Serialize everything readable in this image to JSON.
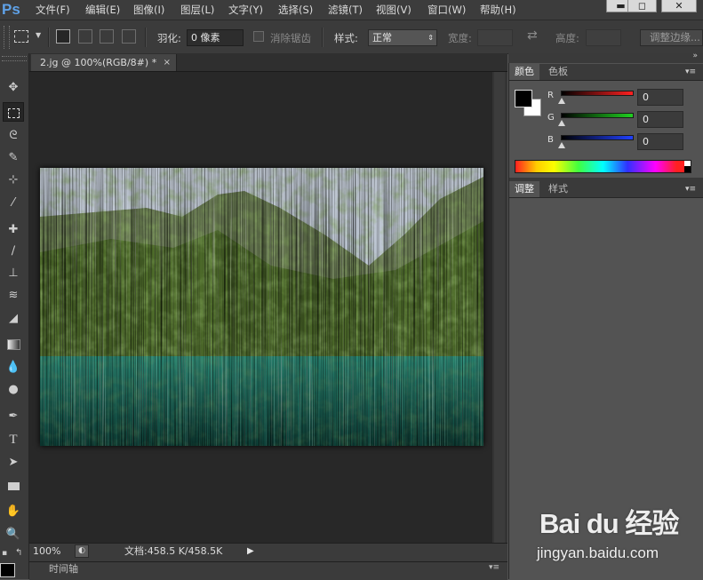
{
  "app": {
    "logo": "Ps"
  },
  "menu": [
    "文件(F)",
    "编辑(E)",
    "图像(I)",
    "图层(L)",
    "文字(Y)",
    "选择(S)",
    "滤镜(T)",
    "视图(V)",
    "窗口(W)",
    "帮助(H)"
  ],
  "window_controls": {
    "minimize": "▬",
    "maximize": "◻",
    "close": "✕"
  },
  "options": {
    "feather_label": "羽化:",
    "feather_value": "0 像素",
    "antialias_label": "消除锯齿",
    "style_label": "样式:",
    "style_value": "正常",
    "width_label": "宽度:",
    "height_label": "高度:",
    "refine_edge": "调整边缘..."
  },
  "document": {
    "tab_title": "2.jg @ 100%(RGB/8#) *",
    "tab_close": "×",
    "zoom": "100%",
    "doc_info": "文档:458.5 K/458.5K"
  },
  "timeline": {
    "label": "时间轴"
  },
  "color_panel": {
    "tabs": [
      "颜色",
      "色板"
    ],
    "channels": [
      {
        "label": "R",
        "value": "0",
        "color": "#ff2020"
      },
      {
        "label": "G",
        "value": "0",
        "color": "#20d020"
      },
      {
        "label": "B",
        "value": "0",
        "color": "#2040ff"
      }
    ]
  },
  "adjust_panel": {
    "tabs": [
      "调整",
      "样式"
    ]
  },
  "watermark": {
    "logo": "Bai du 经验",
    "sub": "jingyan.baidu.com"
  },
  "colors": {
    "accent": "#5fa2e8",
    "workspace": "#282828",
    "panel": "#535353"
  }
}
